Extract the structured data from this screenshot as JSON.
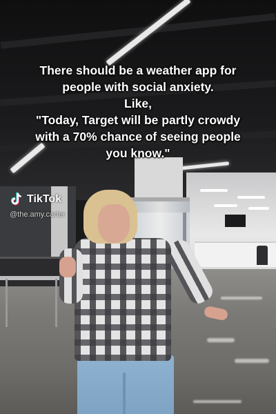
{
  "caption": {
    "lines": [
      "There should be a weather app for",
      "people with social anxiety.",
      "Like,",
      "\"Today, Target will be partly crowdy",
      "with a 70% chance of seeing  people",
      "you know.\""
    ]
  },
  "watermark": {
    "brand": "TikTok",
    "handle": "@the.amy.carter",
    "icon": "tiktok-logo-icon"
  },
  "colors": {
    "caption_text": "#ffffff",
    "jeans": "#8eb2d0",
    "hair": "#d9c191"
  }
}
